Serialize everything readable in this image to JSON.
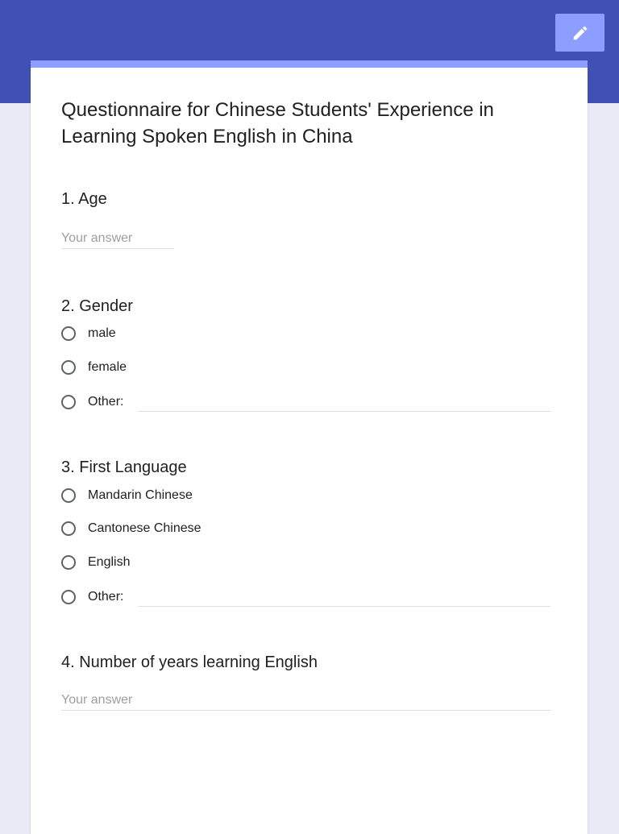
{
  "form": {
    "title": "Questionnaire for Chinese Students' Experience in Learning Spoken English in China",
    "edit_icon": "pencil-icon",
    "colors": {
      "header": "#3f51b5",
      "accent": "#8c9eff",
      "background": "#e8eaf6"
    }
  },
  "questions": {
    "age": {
      "title": "1. Age",
      "placeholder": "Your answer"
    },
    "gender": {
      "title": "2. Gender",
      "options": [
        "male",
        "female",
        "Other:"
      ]
    },
    "first_language": {
      "title": "3. First Language",
      "options": [
        "Mandarin Chinese",
        "Cantonese Chinese",
        "English",
        "Other:"
      ]
    },
    "years": {
      "title": "4. Number of years learning English",
      "placeholder": "Your answer"
    }
  }
}
